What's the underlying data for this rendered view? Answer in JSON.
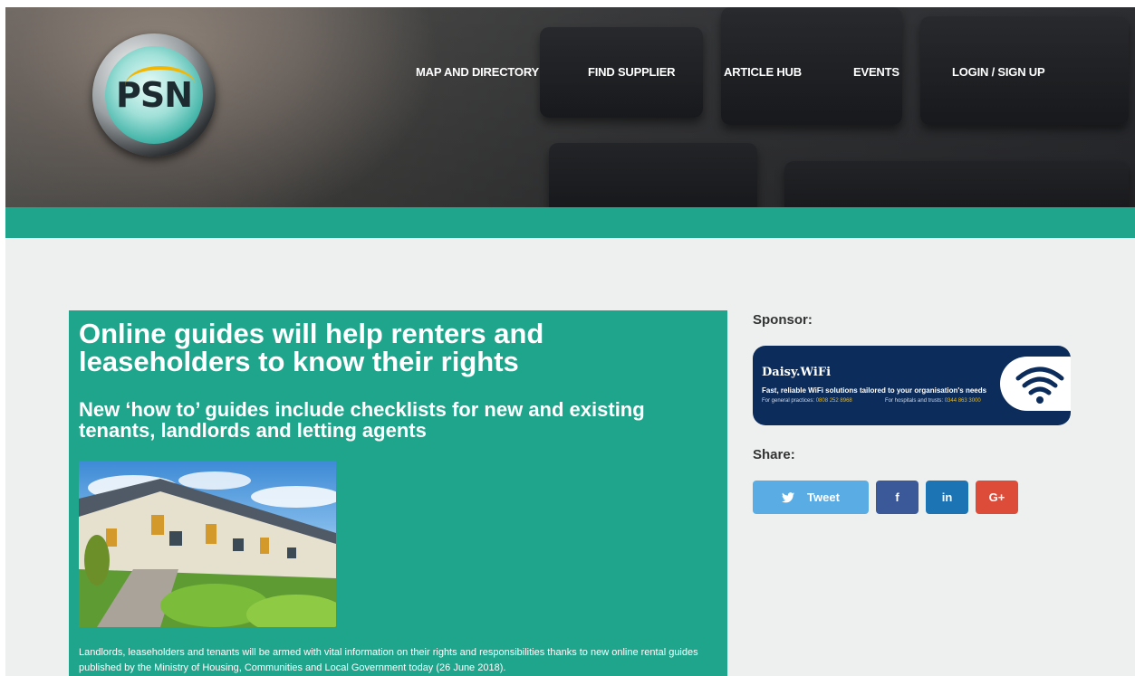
{
  "header": {
    "logo_text": "PSN",
    "nav": [
      {
        "label": "MAP AND DIRECTORY"
      },
      {
        "label": "FIND SUPPLIER"
      },
      {
        "label": "ARTICLE HUB"
      },
      {
        "label": "EVENTS"
      },
      {
        "label": "LOGIN / SIGN UP"
      }
    ]
  },
  "article": {
    "title": "Online guides will help renters and leaseholders to know their rights",
    "subtitle": "New ‘how to’ guides include checklists for new and existing tenants, landlords and letting agents",
    "body": "Landlords, leaseholders and tenants will be armed with vital information on their rights and responsibilities thanks to new online rental guides published by the Ministry of Housing, Communities and Local Government today (26 June 2018)."
  },
  "sidebar": {
    "sponsor_label": "Sponsor:",
    "sponsor": {
      "brand": "Daisy.WiFi",
      "tagline": "Fast, reliable WiFi solutions tailored to your organisation's needs",
      "line1_label": "For general practices: ",
      "line1_number": "0808 252 8968",
      "line2_label": "For hospitals and trusts: ",
      "line2_number": "0344 863 3000"
    },
    "share_label": "Share:",
    "share": {
      "tweet": "Tweet",
      "facebook": "f",
      "linkedin": "in",
      "google": "G+"
    }
  },
  "colors": {
    "teal": "#1ea58b",
    "twitter": "#5aade4",
    "facebook": "#3b5998",
    "linkedin": "#1c74b4",
    "google": "#dd4b39",
    "sponsor_navy": "#0c2d5c"
  }
}
